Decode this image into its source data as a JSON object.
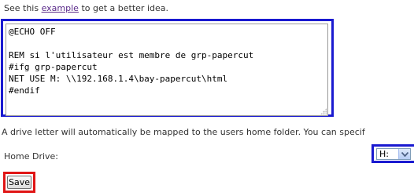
{
  "intro": {
    "before": "See this ",
    "link": "example",
    "after": " to get a better idea."
  },
  "script": {
    "lines": [
      "@ECHO OFF",
      "",
      "REM si l'utilisateur est membre de grp-papercut",
      "#ifg grp-papercut",
      "NET USE M: \\\\192.168.1.4\\bay-papercut\\html",
      "#endif"
    ]
  },
  "note": "A drive letter will automatically be mapped to the users home folder. You can specif",
  "home_drive": {
    "label": "Home Drive:",
    "value": "H:"
  },
  "save_label": "Save",
  "colors": {
    "highlight_blue": "#1a1ad0",
    "highlight_red": "#e01515",
    "link": "#5a2a8a"
  }
}
